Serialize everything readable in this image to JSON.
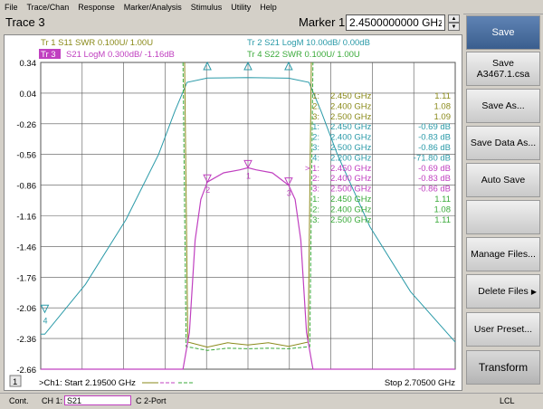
{
  "menu": [
    "File",
    "Trace/Chan",
    "Response",
    "Marker/Analysis",
    "Stimulus",
    "Utility",
    "Help"
  ],
  "toolbar": {
    "trace_title": "Trace 3",
    "marker_label": "Marker 1",
    "marker_value": "2.4500000000 GHz"
  },
  "colors": {
    "tr1": "#8a8a1a",
    "tr2": "#2a9aa8",
    "tr3": "#c040c0",
    "tr4": "#3aaa3a",
    "softkey_accent": "#3a5e8e"
  },
  "traces": {
    "tr1": "Tr  1  S11 SWR 0.100U/  1.00U",
    "tr2": "Tr  2  S21 LogM 10.00dB/  0.00dB",
    "tr3_badge": "Tr  3",
    "tr3": "S21 LogM 0.300dB/  -1.16dB",
    "tr4": "Tr  4  S22 SWR 0.100U/  1.00U"
  },
  "y_ticks": [
    "0.34",
    "0.04",
    "-0.26",
    "-0.56",
    "-0.86",
    "-1.16",
    "-1.46",
    "-1.76",
    "-2.06",
    "-2.36",
    "-2.66"
  ],
  "marker_table": [
    {
      "id": "1:",
      "freq": "2.450  GHz",
      "val": "1.11",
      "color": "#8a8a1a"
    },
    {
      "id": "2:",
      "freq": "2.400  GHz",
      "val": "1.08",
      "color": "#8a8a1a"
    },
    {
      "id": "3:",
      "freq": "2.500  GHz",
      "val": "1.09",
      "color": "#8a8a1a"
    },
    {
      "id": "1:",
      "freq": "2.450  GHz",
      "val": "-0.69 dB",
      "color": "#2a9aa8"
    },
    {
      "id": "2:",
      "freq": "2.400  GHz",
      "val": "-0.83 dB",
      "color": "#2a9aa8"
    },
    {
      "id": "3:",
      "freq": "2.500  GHz",
      "val": "-0.86 dB",
      "color": "#2a9aa8"
    },
    {
      "id": "4:",
      "freq": "2.200  GHz",
      "val": "-71.80 dB",
      "color": "#2a9aa8"
    },
    {
      "id": "> 1:",
      "freq": "2.450  GHz",
      "val": "-0.69 dB",
      "color": "#c040c0"
    },
    {
      "id": "2:",
      "freq": "2.400  GHz",
      "val": "-0.83 dB",
      "color": "#c040c0"
    },
    {
      "id": "3:",
      "freq": "2.500  GHz",
      "val": "-0.86 dB",
      "color": "#c040c0"
    },
    {
      "id": "1:",
      "freq": "2.450  GHz",
      "val": "1.11",
      "color": "#3aaa3a"
    },
    {
      "id": "2:",
      "freq": "2.400  GHz",
      "val": "1.08",
      "color": "#3aaa3a"
    },
    {
      "id": "3:",
      "freq": "2.500  GHz",
      "val": "1.11",
      "color": "#3aaa3a"
    }
  ],
  "chart_footer": {
    "channel_num": "1",
    "start": ">Ch1: Start  2.19500 GHz",
    "stop": "Stop  2.70500 GHz"
  },
  "softkeys": [
    {
      "line1": "Save",
      "line2": "",
      "style": "blue"
    },
    {
      "line1": "Save",
      "line2": "A3467.1.csa",
      "style": "normal"
    },
    {
      "line1": "Save As...",
      "line2": "",
      "style": "normal"
    },
    {
      "line1": "Save Data As...",
      "line2": "",
      "style": "normal"
    },
    {
      "line1": "Auto Save",
      "line2": "",
      "style": "normal"
    },
    {
      "line1": "",
      "line2": "",
      "style": "normal"
    },
    {
      "line1": "Manage Files...",
      "line2": "",
      "style": "normal"
    },
    {
      "line1": "Delete Files",
      "line2": "",
      "style": "normal",
      "arrow": "▶"
    },
    {
      "line1": "User Preset...",
      "line2": "",
      "style": "normal"
    },
    {
      "line1": "Transform",
      "line2": "",
      "style": "dark"
    }
  ],
  "status": {
    "cont": "Cont.",
    "channel": "CH 1:",
    "param": "S21",
    "port": "C  2-Port",
    "lcl": "LCL"
  },
  "chart_data": {
    "type": "line",
    "x_start_ghz": 2.195,
    "x_stop_ghz": 2.705,
    "tr3_scale": {
      "ref": -1.16,
      "per_div": 0.3,
      "top": 0.34,
      "bottom": -2.66
    },
    "series": [
      {
        "name": "S21 LogM (Tr3)",
        "color": "#c040c0",
        "x": [
          2.195,
          2.37,
          2.378,
          2.385,
          2.392,
          2.4,
          2.42,
          2.44,
          2.45,
          2.46,
          2.48,
          2.5,
          2.508,
          2.515,
          2.522,
          2.53,
          2.705
        ],
        "y": [
          -2.66,
          -2.66,
          -2.3,
          -1.4,
          -1.0,
          -0.83,
          -0.74,
          -0.71,
          -0.69,
          -0.71,
          -0.74,
          -0.86,
          -1.0,
          -1.4,
          -2.3,
          -2.66,
          -2.66
        ]
      },
      {
        "name": "S21 LogM (Tr2)",
        "color": "#2a9aa8",
        "x": [
          2.195,
          2.2,
          2.25,
          2.3,
          2.34,
          2.36,
          2.375,
          2.4,
          2.45,
          2.5,
          2.525,
          2.54,
          2.56,
          2.6,
          2.65,
          2.705
        ],
        "y": [
          -71.8,
          -71.8,
          -58,
          -40,
          -22,
          -10,
          -2,
          -0.83,
          -0.69,
          -0.86,
          -2,
          -10,
          -22,
          -42,
          -60,
          -74
        ]
      },
      {
        "name": "S11 SWR (Tr1)",
        "color": "#8a8a1a",
        "x": [
          2.372,
          2.376,
          2.4,
          2.425,
          2.45,
          2.475,
          2.5,
          2.524,
          2.528
        ],
        "y": [
          3.0,
          1.15,
          1.08,
          1.14,
          1.11,
          1.14,
          1.09,
          1.15,
          3.0
        ]
      },
      {
        "name": "S22 SWR (Tr4)",
        "color": "#3aaa3a",
        "x": [
          2.37,
          2.374,
          2.4,
          2.425,
          2.45,
          2.475,
          2.5,
          2.526,
          2.53
        ],
        "y": [
          3.0,
          1.15,
          1.08,
          1.12,
          1.11,
          1.12,
          1.11,
          1.15,
          3.0
        ]
      }
    ],
    "markers": [
      {
        "trace": "Tr3",
        "label": "1",
        "x": 2.45,
        "y": -0.69
      },
      {
        "trace": "Tr3",
        "label": "2",
        "x": 2.4,
        "y": -0.83
      },
      {
        "trace": "Tr3",
        "label": "3",
        "x": 2.5,
        "y": -0.86
      },
      {
        "trace": "Tr2",
        "label": "4",
        "x": 2.2,
        "y": -71.8
      }
    ]
  }
}
